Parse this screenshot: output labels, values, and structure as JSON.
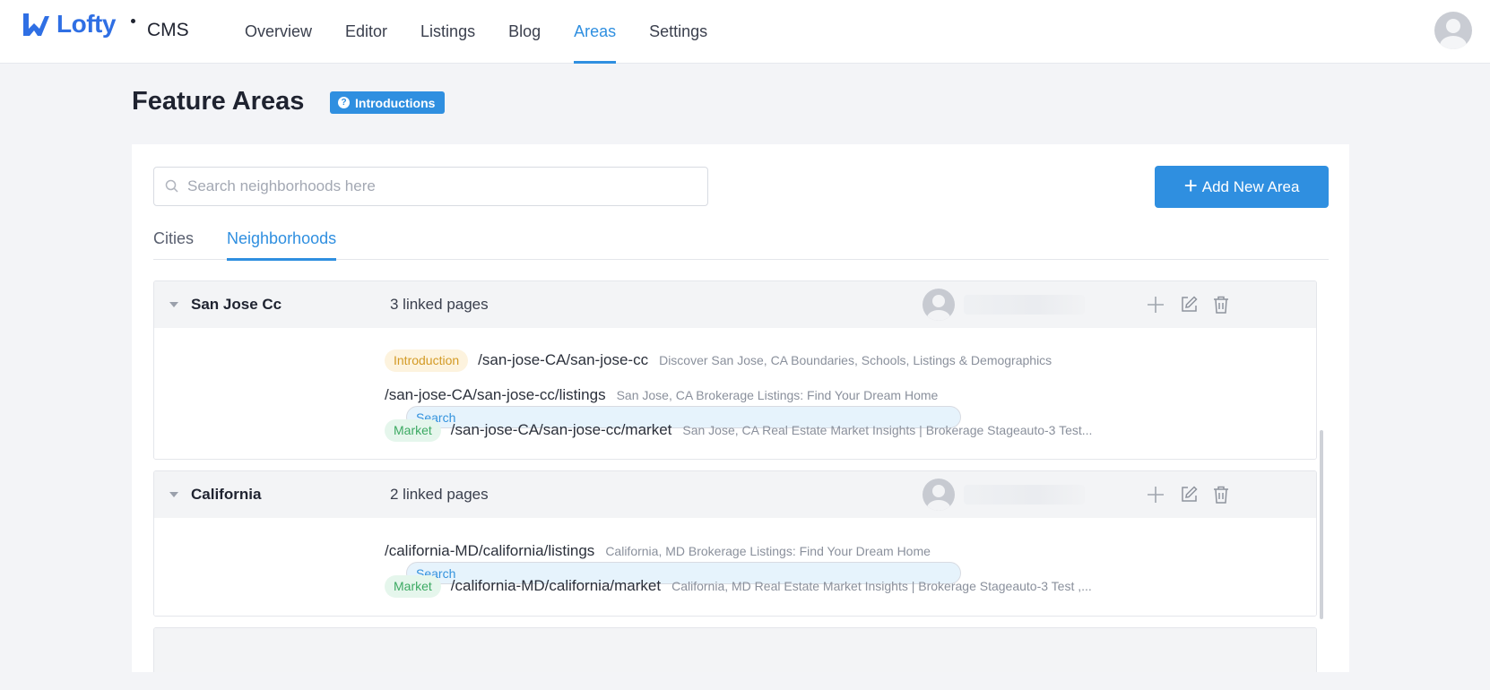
{
  "nav": {
    "logo_text": "Lofty",
    "product": "CMS",
    "items": [
      {
        "label": "Overview",
        "active": false
      },
      {
        "label": "Editor",
        "active": false
      },
      {
        "label": "Listings",
        "active": false
      },
      {
        "label": "Blog",
        "active": false
      },
      {
        "label": "Areas",
        "active": true
      },
      {
        "label": "Settings",
        "active": false
      }
    ]
  },
  "page": {
    "title": "Feature Areas",
    "badge": "Introductions"
  },
  "toolbar": {
    "search_placeholder": "Search neighborhoods here",
    "add_button": "Add New Area"
  },
  "tabs": [
    {
      "label": "Cities",
      "active": false
    },
    {
      "label": "Neighborhoods",
      "active": true
    }
  ],
  "areas": [
    {
      "name": "San Jose Cc",
      "linked": "3 linked pages",
      "pages": [
        {
          "tag": "Introduction",
          "type": "intro",
          "path": "/san-jose-CA/san-jose-cc",
          "desc": "Discover San Jose, CA Boundaries, Schools, Listings & Demographics"
        },
        {
          "tag": "Search",
          "type": "search",
          "path": "/san-jose-CA/san-jose-cc/listings",
          "desc": "San Jose, CA Brokerage Listings: Find Your Dream Home"
        },
        {
          "tag": "Market",
          "type": "market",
          "path": "/san-jose-CA/san-jose-cc/market",
          "desc": "San Jose, CA Real Estate Market Insights | Brokerage Stageauto-3 Test..."
        }
      ]
    },
    {
      "name": "California",
      "linked": "2 linked pages",
      "pages": [
        {
          "tag": "Search",
          "type": "search",
          "path": "/california-MD/california/listings",
          "desc": "California, MD Brokerage Listings: Find Your Dream Home"
        },
        {
          "tag": "Market",
          "type": "market",
          "path": "/california-MD/california/market",
          "desc": "California, MD Real Estate Market Insights | Brokerage Stageauto-3 Test ,..."
        }
      ]
    }
  ],
  "colors": {
    "accent": "#2f8fe0",
    "brand": "#2f6fe4",
    "intro_tag": "#d39a25",
    "search_tag": "#3493dd",
    "market_tag": "#3daa63"
  }
}
